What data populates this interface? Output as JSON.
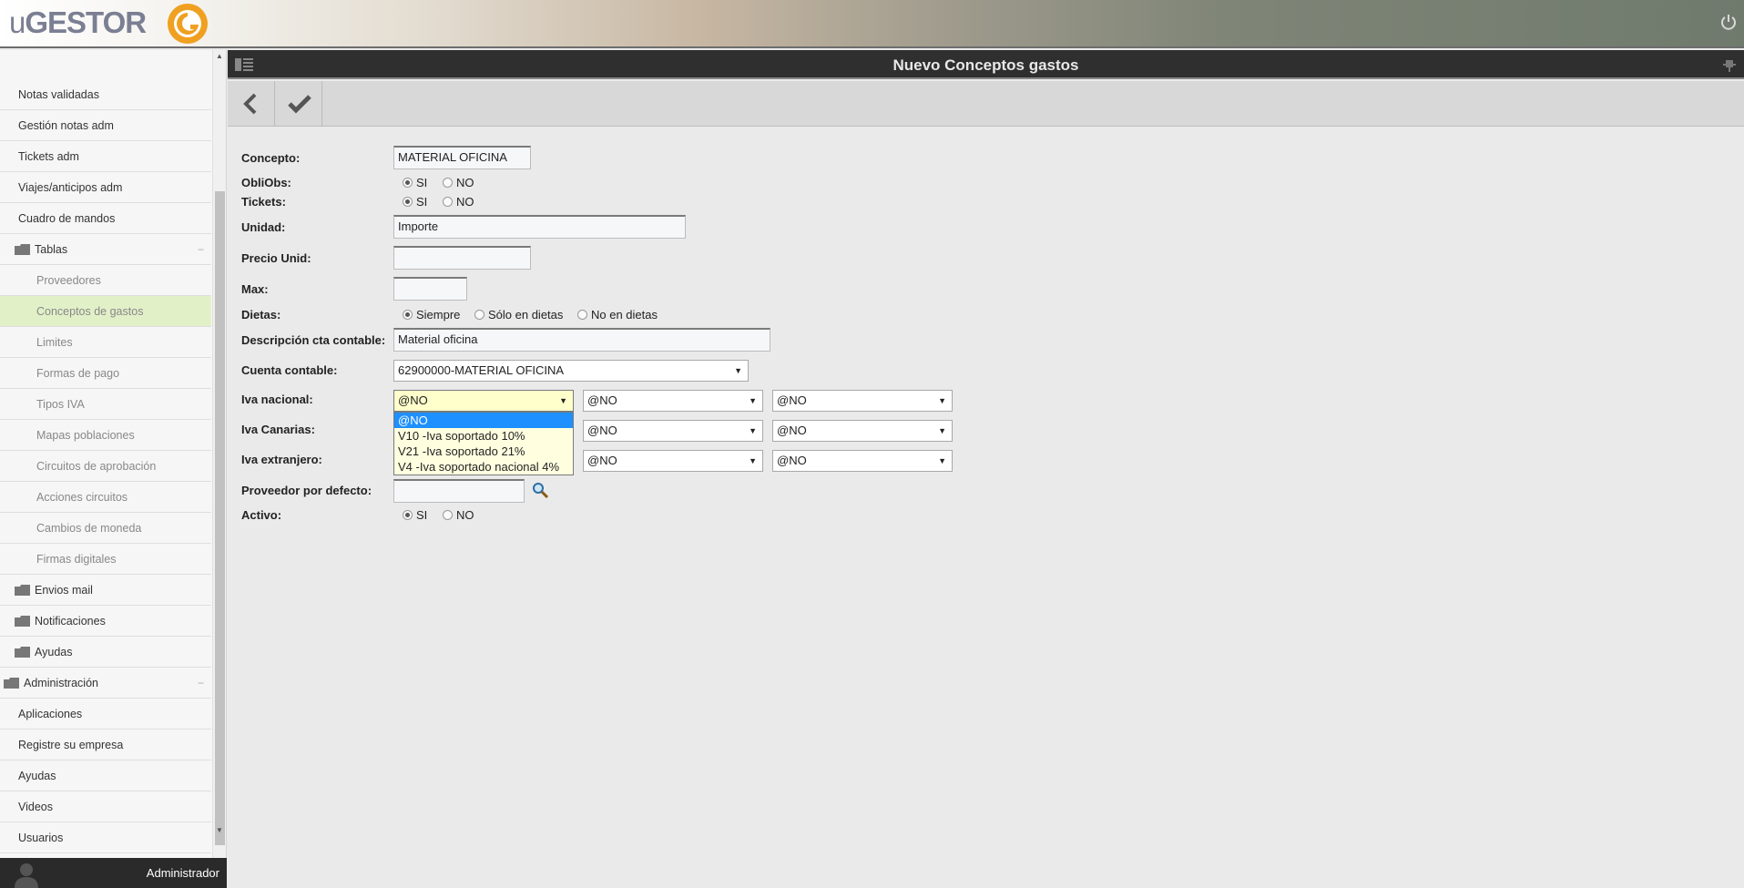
{
  "app": {
    "logo_u": "u",
    "logo_rest": "GESTOR",
    "page_title": "Nuevo Conceptos gastos",
    "user": "Administrador",
    "colors": {
      "accent_active": "#e2f0c8",
      "header": "#2f2f2f",
      "logo_orange": "#f0a020"
    }
  },
  "sidebar": {
    "items": [
      {
        "label": "Notas validadas"
      },
      {
        "label": "Gestión notas adm"
      },
      {
        "label": "Tickets adm"
      },
      {
        "label": "Viajes/anticipos adm"
      },
      {
        "label": "Cuadro de mandos"
      },
      {
        "label": "Tablas",
        "collapse": "−"
      },
      {
        "label": "Proveedores"
      },
      {
        "label": "Conceptos de gastos"
      },
      {
        "label": "Limites"
      },
      {
        "label": "Formas de pago"
      },
      {
        "label": "Tipos IVA"
      },
      {
        "label": "Mapas poblaciones"
      },
      {
        "label": "Circuitos de aprobación"
      },
      {
        "label": "Acciones circuitos"
      },
      {
        "label": "Cambios de moneda"
      },
      {
        "label": "Firmas digitales"
      },
      {
        "label": "Envios mail"
      },
      {
        "label": "Notificaciones"
      },
      {
        "label": "Ayudas"
      },
      {
        "label": "Administración",
        "collapse": "−"
      },
      {
        "label": "Aplicaciones"
      },
      {
        "label": "Registre su empresa"
      },
      {
        "label": "Ayudas"
      },
      {
        "label": "Videos"
      },
      {
        "label": "Usuarios"
      }
    ]
  },
  "form": {
    "concepto": {
      "label": "Concepto:",
      "value": "MATERIAL OFICINA"
    },
    "obliobs": {
      "label": "ObliObs:",
      "opt_si": "SI",
      "opt_no": "NO",
      "selected": "SI"
    },
    "tickets": {
      "label": "Tickets:",
      "opt_si": "SI",
      "opt_no": "NO",
      "selected": "SI"
    },
    "unidad": {
      "label": "Unidad:",
      "value": "Importe"
    },
    "precio": {
      "label": "Precio Unid:",
      "value": ""
    },
    "max": {
      "label": "Max:",
      "value": ""
    },
    "dietas": {
      "label": "Dietas:",
      "opt1": "Siempre",
      "opt2": "Sólo en dietas",
      "opt3": "No en dietas",
      "selected": "Siempre"
    },
    "descripcion": {
      "label": "Descripción cta contable:",
      "value": "Material oficina"
    },
    "cuenta": {
      "label": "Cuenta contable:",
      "value": "62900000-MATERIAL OFICINA"
    },
    "iva_nacional": {
      "label": "Iva nacional:",
      "v1": "@NO",
      "v2": "@NO",
      "v3": "@NO"
    },
    "iva_canarias": {
      "label": "Iva Canarias:",
      "v2": "@NO",
      "v3": "@NO"
    },
    "iva_extranjero": {
      "label": "Iva extranjero:",
      "v2": "@NO",
      "v3": "@NO"
    },
    "proveedor": {
      "label": "Proveedor por defecto:",
      "value": ""
    },
    "activo": {
      "label": "Activo:",
      "opt_si": "SI",
      "opt_no": "NO",
      "selected": "SI"
    }
  },
  "dropdown": {
    "options": [
      "@NO",
      "V10 -Iva soportado 10%",
      "V21 -Iva soportado 21%",
      "V4 -Iva soportado nacional 4%"
    ],
    "highlighted": "@NO"
  }
}
